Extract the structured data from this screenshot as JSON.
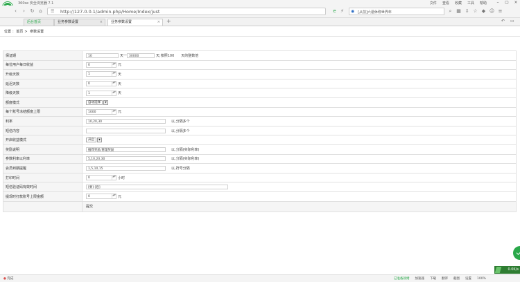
{
  "window": {
    "title": "360se 安全浏览器 7.1",
    "menu": [
      "文件",
      "查看",
      "收藏",
      "工具",
      "帮助"
    ],
    "controls": [
      "minimize",
      "maximize",
      "close"
    ]
  },
  "browser": {
    "url": "http://127.0.0.1/admin.php/Home/Index/just",
    "search_text": "[从前]六退休称世界年",
    "tabs": [
      {
        "label": "后台首页",
        "active": false
      },
      {
        "label": "业务参数设置",
        "active": false
      },
      {
        "label": "业务参数设置",
        "active": true
      }
    ],
    "new_tab": "+"
  },
  "breadcrumb": [
    "位置",
    "首页",
    "参数设置"
  ],
  "form": {
    "rows": [
      {
        "label": "保证期",
        "type": "range",
        "v1": "10",
        "sep": "天一",
        "v2": "30000",
        "mid": "天;按照100",
        "tail": "天的整数倍"
      },
      {
        "label": "每位用户每日收益",
        "type": "spin",
        "value": "0",
        "unit": "元"
      },
      {
        "label": "升级天数",
        "type": "spin",
        "value": "1",
        "unit": "天"
      },
      {
        "label": "延迟天数",
        "type": "spin",
        "value": "0",
        "unit": "天"
      },
      {
        "label": "降级天数",
        "type": "spin",
        "value": "1",
        "unit": "天"
      },
      {
        "label": "额度模式",
        "type": "select",
        "value": "自动选择"
      },
      {
        "label": "每个账号冻结额度上限",
        "type": "spin",
        "value": "1000",
        "unit": "元"
      },
      {
        "label": "利率",
        "type": "text",
        "value": "10,20,30",
        "hint": "以,分隔多个"
      },
      {
        "label": "短信内容",
        "type": "text",
        "value": "",
        "hint": "以,分隔多个"
      },
      {
        "label": "开启收益模式",
        "type": "select",
        "value": "开启"
      },
      {
        "label": "奖励说明",
        "type": "text",
        "value": "推荐奖励,管理奖励",
        "hint": "以,分隔(实际利率)"
      },
      {
        "label": "参数利率以利率",
        "type": "text",
        "value": "5,10,20,30",
        "hint": "以,分隔(实际利率)"
      },
      {
        "label": "会员到期提醒",
        "type": "text",
        "value": "1,5,10,15",
        "hint": "以,符号分隔"
      },
      {
        "label": "打印时间",
        "type": "spin",
        "value": "0",
        "unit": "小时"
      },
      {
        "label": "短信验证码有效时间",
        "type": "wide",
        "value": "[要]-[后]"
      },
      {
        "label": "提现时打款账号上限金额",
        "type": "spin",
        "value": "0",
        "unit": "元"
      }
    ],
    "submit_label": "提交"
  },
  "float_widget": {
    "speed": "0.0K/s"
  },
  "statusbar": {
    "left": "完成",
    "right": [
      "已准备就绪",
      "加速器",
      "下载",
      "翻译",
      "截图",
      "设置",
      "100%"
    ]
  }
}
